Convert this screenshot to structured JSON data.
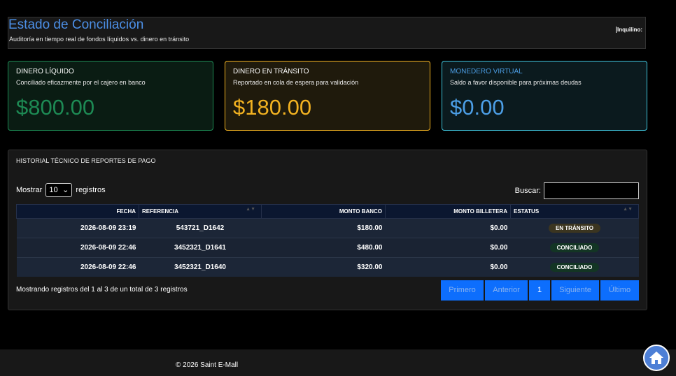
{
  "header": {
    "title": "Estado de Conciliación",
    "subtitle": "Auditoría en tiempo real de fondos líquidos vs. dinero en tránsito",
    "tenant_label": "Inquilino:"
  },
  "cards": [
    {
      "title": "DINERO LÍQUIDO",
      "desc": "Conciliado eficazmente por el cajero en banco",
      "value": "$800.00",
      "color": "#1d8a54"
    },
    {
      "title": "DINERO EN TRÁNSITO",
      "desc": "Reportado en cola de espera para validación",
      "value": "$180.00",
      "color": "#f2b221"
    },
    {
      "title": "MONEDERO VIRTUAL",
      "desc": "Saldo a favor disponible para próximas deudas",
      "value": "$0.00",
      "color": "#4c9ee6"
    }
  ],
  "history": {
    "title": "HISTORIAL TÉCNICO DE REPORTES DE PAGO",
    "show_label": "Mostrar",
    "show_value": "10",
    "records_label": "registros",
    "search_label": "Buscar:",
    "columns": [
      "FECHA",
      "REFERENCIA",
      "MONTO BANCO",
      "MONTO BILLETERA",
      "ESTATUS"
    ],
    "rows": [
      {
        "date": "2026-08-09 23:19",
        "ref": "543721_D1642",
        "bank": "$180.00",
        "wallet": "$0.00",
        "status": "EN TRÁNSITO"
      },
      {
        "date": "2026-08-09 22:46",
        "ref": "3452321_D1641",
        "bank": "$480.00",
        "wallet": "$0.00",
        "status": "CONCILIADO"
      },
      {
        "date": "2026-08-09 22:46",
        "ref": "3452321_D1640",
        "bank": "$320.00",
        "wallet": "$0.00",
        "status": "CONCILIADO"
      }
    ],
    "info": "Mostrando registros del 1 al 3 de un total de 3 registros",
    "pager": {
      "first": "Primero",
      "prev": "Anterior",
      "page": "1",
      "next": "Siguiente",
      "last": "Último"
    }
  },
  "footer": {
    "copyright": "© 2026 Saint E-Mall"
  },
  "icons": {
    "home": "home-icon",
    "sort": "sort-icon",
    "dropdown": "chevron-down-icon"
  }
}
